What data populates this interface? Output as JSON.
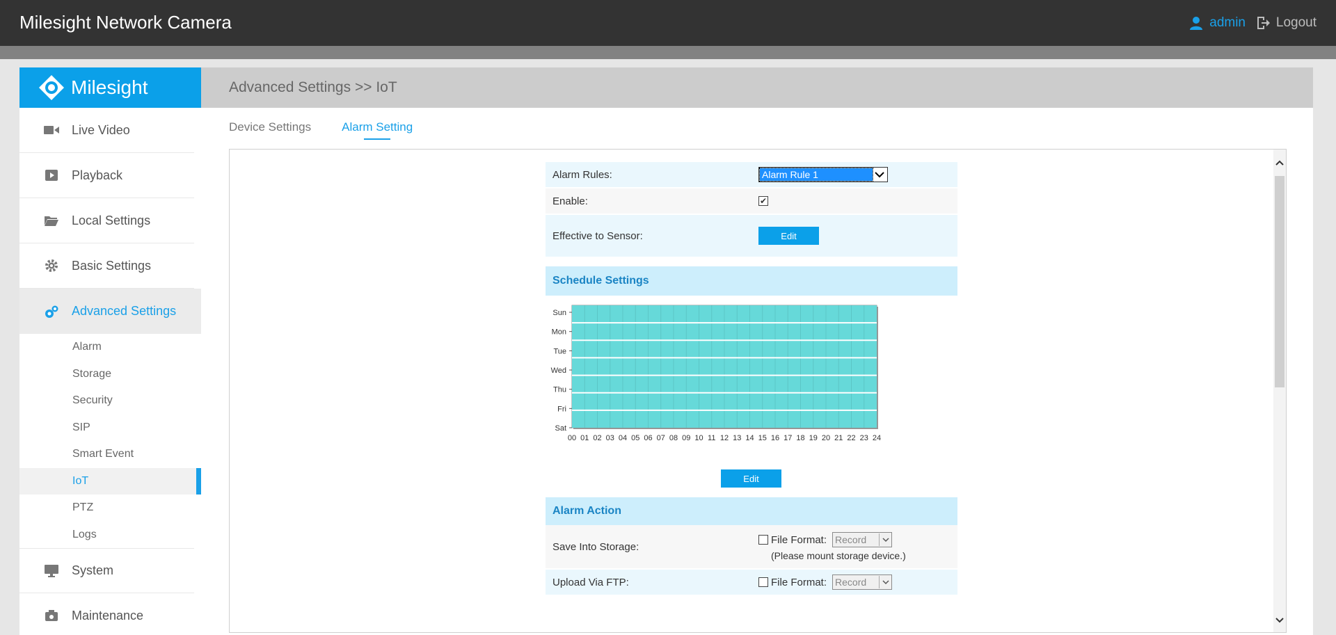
{
  "app": {
    "title": "Milesight Network Camera",
    "user": "admin",
    "logout": "Logout",
    "accent": "#0ba0e9"
  },
  "sidebar": {
    "brand": "Milesight",
    "items": [
      {
        "label": "Live Video",
        "icon": "video-camera-icon"
      },
      {
        "label": "Playback",
        "icon": "play-icon"
      },
      {
        "label": "Local Settings",
        "icon": "folder-icon"
      },
      {
        "label": "Basic Settings",
        "icon": "gear-icon"
      },
      {
        "label": "Advanced Settings",
        "icon": "gears-icon"
      }
    ],
    "sub_items": [
      "Alarm",
      "Storage",
      "Security",
      "SIP",
      "Smart Event",
      "IoT",
      "PTZ",
      "Logs"
    ],
    "bottom_items": [
      {
        "label": "System",
        "icon": "monitor-icon"
      },
      {
        "label": "Maintenance",
        "icon": "camera-box-icon"
      }
    ]
  },
  "main": {
    "breadcrumb": "Advanced Settings >> IoT",
    "tabs": [
      "Device Settings",
      "Alarm Setting"
    ]
  },
  "form": {
    "alarm_rules_label": "Alarm Rules:",
    "alarm_rules_value": "Alarm Rule 1",
    "enable_label": "Enable:",
    "enable_checked": true,
    "effective_label": "Effective to Sensor:",
    "edit_label": "Edit",
    "schedule_title": "Schedule Settings",
    "schedule_edit_label": "Edit",
    "alarm_action_title": "Alarm Action",
    "save_storage_label": "Save Into Storage:",
    "upload_ftp_label": "Upload Via FTP:",
    "file_format_label": "File Format:",
    "file_format_value": "Record",
    "mount_note": "(Please mount storage device.)"
  },
  "chart_data": {
    "type": "heatmap",
    "y_categories": [
      "Sun",
      "Mon",
      "Tue",
      "Wed",
      "Thu",
      "Fri",
      "Sat"
    ],
    "x_ticks": [
      "00",
      "01",
      "02",
      "03",
      "04",
      "05",
      "06",
      "07",
      "08",
      "09",
      "10",
      "11",
      "12",
      "13",
      "14",
      "15",
      "16",
      "17",
      "18",
      "19",
      "20",
      "21",
      "22",
      "23",
      "24"
    ],
    "x_range": [
      0,
      24
    ],
    "schedule": [
      {
        "day": "Sun",
        "start": 0,
        "end": 24
      },
      {
        "day": "Mon",
        "start": 0,
        "end": 24
      },
      {
        "day": "Tue",
        "start": 0,
        "end": 24
      },
      {
        "day": "Wed",
        "start": 0,
        "end": 24
      },
      {
        "day": "Thu",
        "start": 0,
        "end": 24
      },
      {
        "day": "Fri",
        "start": 0,
        "end": 24
      },
      {
        "day": "Sat",
        "start": 0,
        "end": 24
      }
    ],
    "fill_color": "#66d9d9"
  }
}
